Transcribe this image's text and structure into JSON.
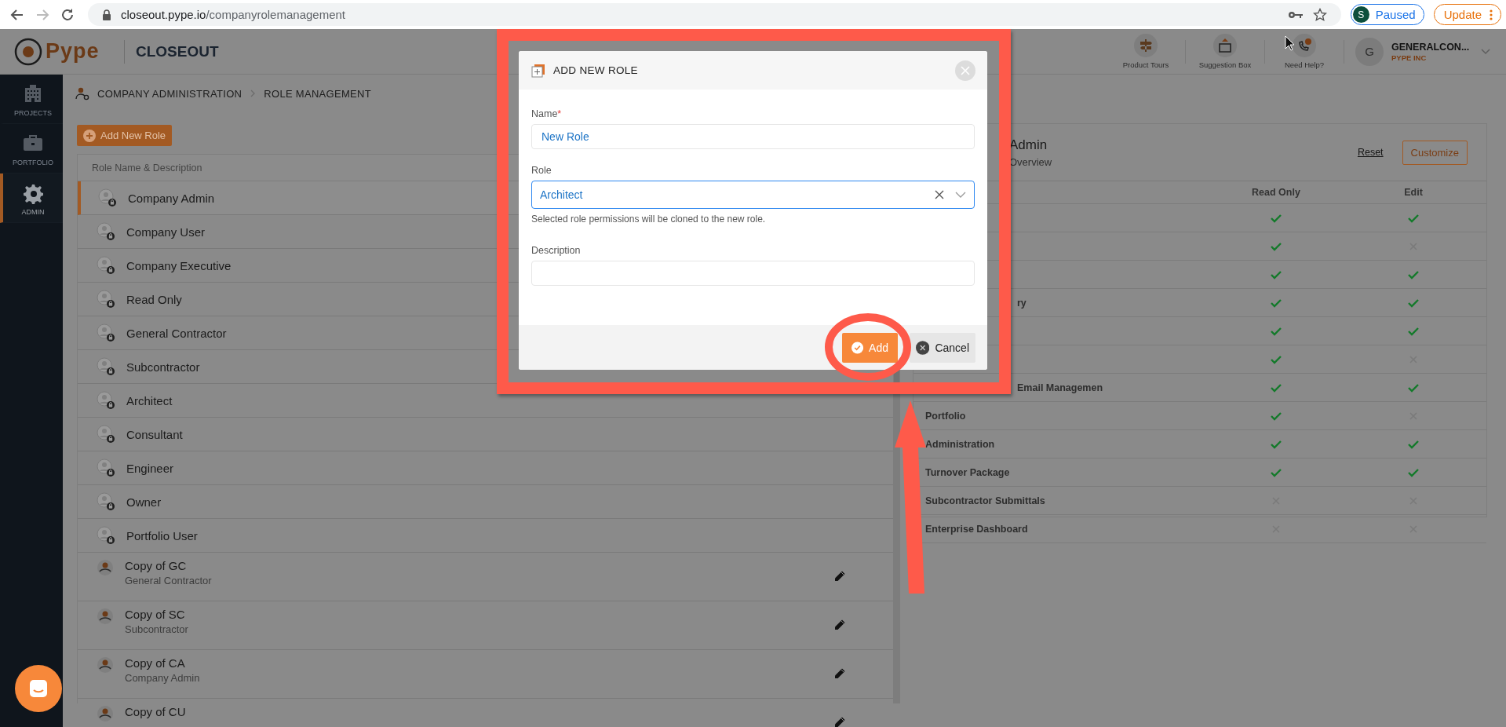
{
  "browser": {
    "url_host": "closeout.pype.io",
    "url_path": "/companyrolemanagement",
    "profile": {
      "initial": "S",
      "label": "Paused"
    },
    "update_label": "Update"
  },
  "header": {
    "logo": "Pype",
    "product": "CLOSEOUT",
    "actions": [
      {
        "kind": "tours",
        "label": "Product Tours"
      },
      {
        "kind": "suggestion",
        "label": "Suggestion Box"
      },
      {
        "kind": "help",
        "label": "Need Help?"
      }
    ],
    "user": {
      "initial": "G",
      "name": "GENERALCON...",
      "company": "PYPE INC"
    }
  },
  "sidebar": {
    "items": [
      {
        "kind": "projects",
        "label": "PROJECTS",
        "selected": false
      },
      {
        "kind": "portfolio",
        "label": "PORTFOLIO",
        "selected": false
      },
      {
        "kind": "admin",
        "label": "ADMIN",
        "selected": true
      }
    ]
  },
  "breadcrumb": [
    "COMPANY ADMINISTRATION",
    "ROLE MANAGEMENT"
  ],
  "add_role_button": "Add New Role",
  "roles_table": {
    "column": "Role Name & Description",
    "rows": [
      {
        "kind": "locked",
        "name": "Company Admin",
        "selected": true
      },
      {
        "kind": "locked",
        "name": "Company User",
        "selected": false
      },
      {
        "kind": "locked",
        "name": "Company Executive",
        "selected": false
      },
      {
        "kind": "locked",
        "name": "Read Only",
        "selected": false
      },
      {
        "kind": "locked",
        "name": "General Contractor",
        "selected": false
      },
      {
        "kind": "locked",
        "name": "Subcontractor",
        "selected": false
      },
      {
        "kind": "locked",
        "name": "Architect",
        "selected": false
      },
      {
        "kind": "locked",
        "name": "Consultant",
        "selected": false
      },
      {
        "kind": "locked",
        "name": "Engineer",
        "selected": false
      },
      {
        "kind": "locked",
        "name": "Owner",
        "selected": false
      },
      {
        "kind": "locked",
        "name": "Portfolio User",
        "selected": false
      },
      {
        "kind": "custom",
        "name": "Copy of GC",
        "description": "General Contractor",
        "selected": false
      },
      {
        "kind": "custom",
        "name": "Copy of SC",
        "description": "Subcontractor",
        "selected": false
      },
      {
        "kind": "custom",
        "name": "Copy of CA",
        "description": "Company Admin",
        "selected": false
      },
      {
        "kind": "custom",
        "name": "Copy of CU",
        "selected": false
      }
    ]
  },
  "permissions": {
    "title": "Admin",
    "subtitle": "Overview",
    "reset": "Reset",
    "customize": "Customize",
    "columns": [
      "Read Only",
      "Edit"
    ],
    "rows": [
      {
        "read": true,
        "edit": true
      },
      {
        "read": true,
        "edit": false
      },
      {
        "read": true,
        "edit": true
      },
      {
        "label": "ry",
        "cut": true,
        "read": true,
        "edit": true
      },
      {
        "read": true,
        "edit": true
      },
      {
        "read": true,
        "edit": false
      },
      {
        "label": "Email Managemen",
        "cut": true,
        "read": true,
        "edit": true
      },
      {
        "label": "Portfolio",
        "cut": false,
        "read": true,
        "edit": false
      },
      {
        "label": "Administration",
        "cut": false,
        "read": true,
        "edit": true
      },
      {
        "label": "Turnover Package",
        "cut": false,
        "read": true,
        "edit": true
      },
      {
        "label": "Subcontractor Submittals",
        "cut": false,
        "read": false,
        "edit": false
      },
      {
        "label": "Enterprise Dashboard",
        "cut": false,
        "read": false,
        "edit": false
      }
    ]
  },
  "modal": {
    "title": "ADD NEW ROLE",
    "name_field": {
      "label": "Name",
      "required_mark": "*",
      "value": "New Role"
    },
    "role_field": {
      "label": "Role",
      "value": "Architect",
      "focused": true,
      "hint": "Selected role permissions will be cloned to the new role."
    },
    "description_field": {
      "label": "Description"
    },
    "buttons": [
      {
        "kind": "primary",
        "label": "Add"
      },
      {
        "kind": "cancel",
        "label": "Cancel"
      }
    ]
  }
}
